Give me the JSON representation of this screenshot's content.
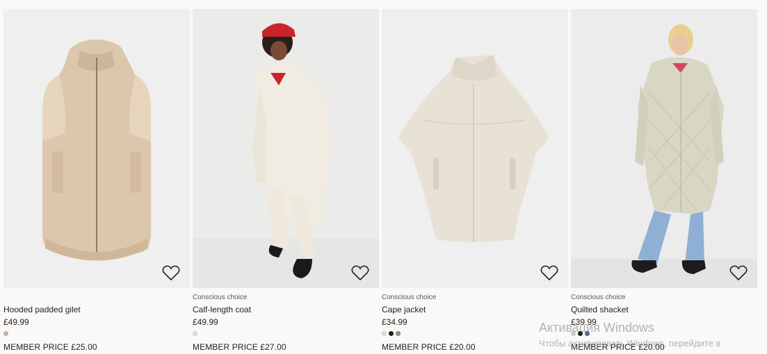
{
  "products": [
    {
      "tag": "",
      "title": "Hooded padded gilet",
      "price": "£49.99",
      "member_price": "MEMBER PRICE £25.00",
      "swatches": [
        "#c9b8a3"
      ],
      "image_bg": "#efefef",
      "icon": "heart-icon"
    },
    {
      "tag": "Conscious choice",
      "title": "Calf-length coat",
      "price": "£49.99",
      "member_price": "MEMBER PRICE £27.00",
      "swatches": [
        "#e3e0d3"
      ],
      "image_bg": "#ebebea",
      "icon": "heart-icon"
    },
    {
      "tag": "Conscious choice",
      "title": "Cape jacket",
      "price": "£34.99",
      "member_price": "MEMBER PRICE £20.00",
      "swatches": [
        "#e2ddd5",
        "#1f1f1f",
        "#9c8f7d"
      ],
      "image_bg": "#efefef",
      "icon": "heart-icon"
    },
    {
      "tag": "Conscious choice",
      "title": "Quilted shacket",
      "price": "£39.99",
      "member_price": "MEMBER PRICE £20.00",
      "swatches": [
        "#d6d3c5",
        "#1f1f1f",
        "#4a6a8f"
      ],
      "image_bg": "#ececec",
      "icon": "heart-icon"
    }
  ],
  "watermark": {
    "line1": "Активация Windows",
    "line2": "Чтобы активировать Windows, перейдите в"
  }
}
